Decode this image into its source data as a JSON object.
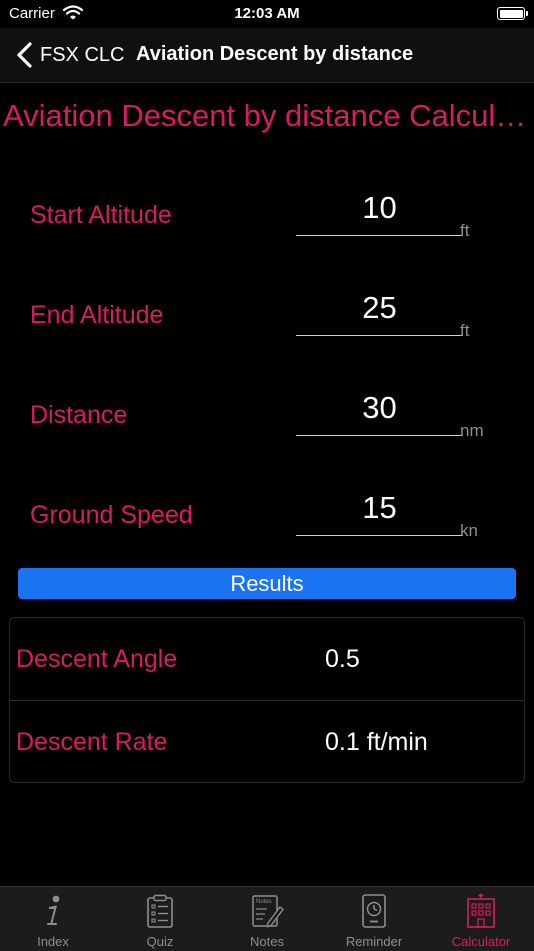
{
  "status_bar": {
    "carrier": "Carrier",
    "time": "12:03 AM"
  },
  "nav": {
    "back_label": "FSX CLC",
    "title": "Aviation Descent by distance"
  },
  "calculator": {
    "title": "Aviation Descent by distance Calculator",
    "fields": [
      {
        "label": "Start Altitude",
        "value": "10",
        "unit": "ft"
      },
      {
        "label": "End Altitude",
        "value": "25",
        "unit": "ft"
      },
      {
        "label": "Distance",
        "value": "30",
        "unit": "nm"
      },
      {
        "label": "Ground Speed",
        "value": "15",
        "unit": "kn"
      }
    ],
    "results_button_label": "Results",
    "results": [
      {
        "label": "Descent Angle",
        "value": "0.5"
      },
      {
        "label": "Descent Rate",
        "value": "0.1 ft/min"
      }
    ]
  },
  "tab_bar": {
    "active_color": "#d81b63",
    "inactive_color": "#8e8e8e",
    "tabs": [
      {
        "label": "Index",
        "icon": "info-icon"
      },
      {
        "label": "Quiz",
        "icon": "clipboard-list-icon"
      },
      {
        "label": "Notes",
        "icon": "notes-pencil-icon",
        "icon_text": "Notes"
      },
      {
        "label": "Reminder",
        "icon": "clock-device-icon"
      },
      {
        "label": "Calculator",
        "icon": "calculator-building-icon",
        "active": true
      }
    ]
  }
}
